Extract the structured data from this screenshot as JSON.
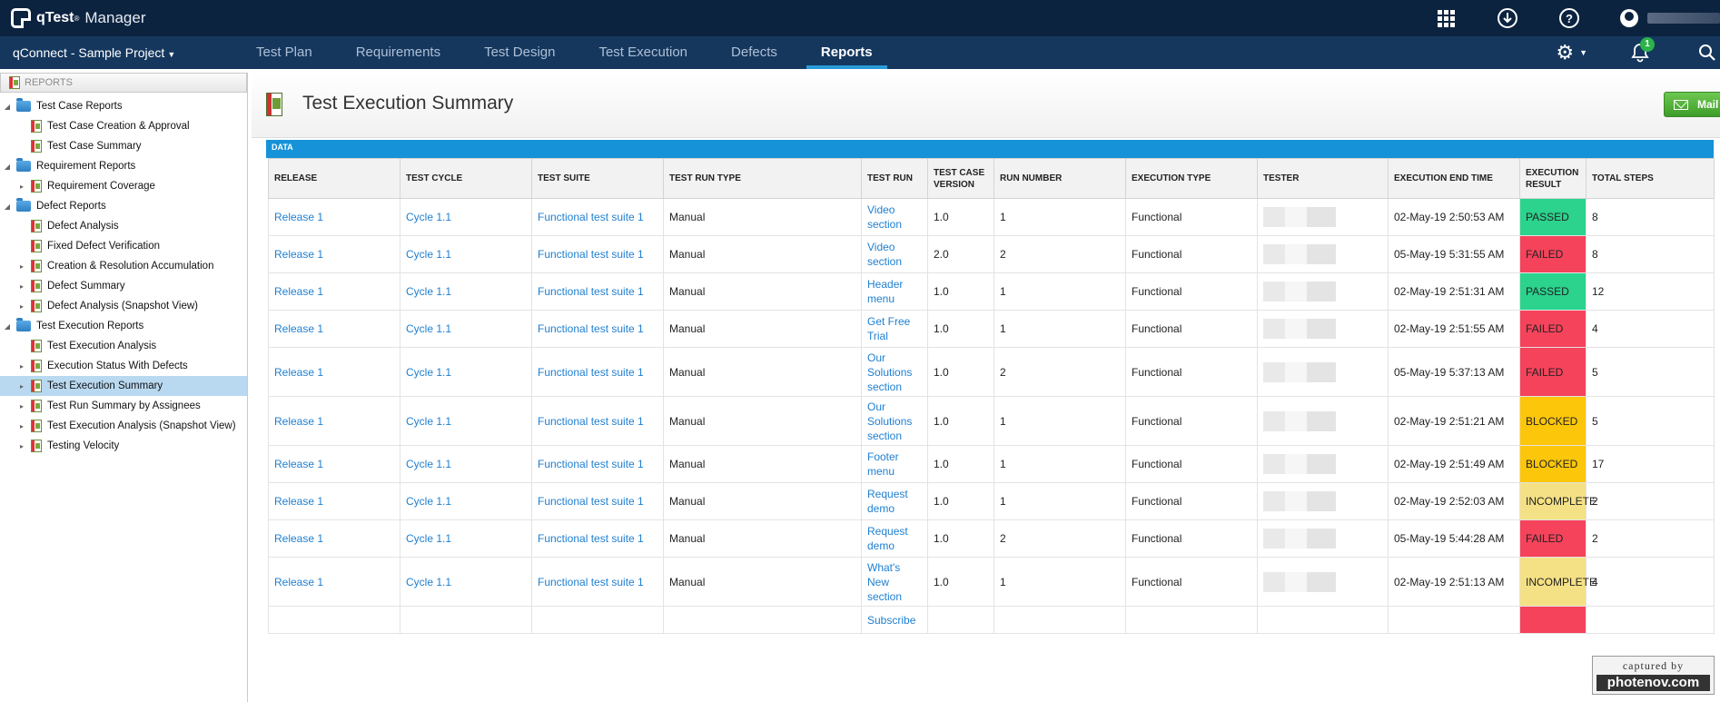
{
  "app": {
    "brand": "qTest",
    "trademark": "®",
    "product": "Manager"
  },
  "nav": {
    "project": "qConnect - Sample Project",
    "tabs": [
      {
        "label": "Test Plan",
        "active": false
      },
      {
        "label": "Requirements",
        "active": false
      },
      {
        "label": "Test Design",
        "active": false
      },
      {
        "label": "Test Execution",
        "active": false
      },
      {
        "label": "Defects",
        "active": false
      },
      {
        "label": "Reports",
        "active": true
      }
    ],
    "notification_count": "1",
    "help_icon": "?"
  },
  "sidebar": {
    "header": "REPORTS",
    "tree": [
      {
        "label": "Test Case Reports",
        "type": "folder",
        "level": 0,
        "expanded": true
      },
      {
        "label": "Test Case Creation & Approval",
        "type": "report",
        "level": 1,
        "expandable": false
      },
      {
        "label": "Test Case Summary",
        "type": "report",
        "level": 1,
        "expandable": false
      },
      {
        "label": "Requirement Reports",
        "type": "folder",
        "level": 0,
        "expanded": true
      },
      {
        "label": "Requirement Coverage",
        "type": "report",
        "level": 1,
        "expandable": true
      },
      {
        "label": "Defect Reports",
        "type": "folder",
        "level": 0,
        "expanded": true
      },
      {
        "label": "Defect Analysis",
        "type": "report",
        "level": 1,
        "expandable": false
      },
      {
        "label": "Fixed Defect Verification",
        "type": "report",
        "level": 1,
        "expandable": false
      },
      {
        "label": "Creation & Resolution Accumulation",
        "type": "report",
        "level": 1,
        "expandable": true
      },
      {
        "label": "Defect Summary",
        "type": "report",
        "level": 1,
        "expandable": true
      },
      {
        "label": "Defect Analysis (Snapshot View)",
        "type": "report",
        "level": 1,
        "expandable": true
      },
      {
        "label": "Test Execution Reports",
        "type": "folder",
        "level": 0,
        "expanded": true
      },
      {
        "label": "Test Execution Analysis",
        "type": "report",
        "level": 1,
        "expandable": false
      },
      {
        "label": "Execution Status With Defects",
        "type": "report",
        "level": 1,
        "expandable": true
      },
      {
        "label": "Test Execution Summary",
        "type": "report",
        "level": 1,
        "expandable": true,
        "selected": true
      },
      {
        "label": "Test Run Summary by Assignees",
        "type": "report",
        "level": 1,
        "expandable": true
      },
      {
        "label": "Test Execution Analysis (Snapshot View)",
        "type": "report",
        "level": 1,
        "expandable": true
      },
      {
        "label": "Testing Velocity",
        "type": "report",
        "level": 1,
        "expandable": true
      }
    ]
  },
  "main": {
    "title": "Test Execution Summary",
    "mail_label": "Mail",
    "data_label": "DATA",
    "columns": [
      "RELEASE",
      "TEST CYCLE",
      "TEST SUITE",
      "TEST RUN TYPE",
      "TEST RUN",
      "TEST CASE VERSION",
      "RUN NUMBER",
      "EXECUTION TYPE",
      "TESTER",
      "EXECUTION END TIME",
      "EXECUTION RESULT",
      "TOTAL STEPS"
    ],
    "rows": [
      {
        "release": "Release 1",
        "cycle": "Cycle 1.1",
        "suite": "Functional test suite 1",
        "run_type": "Manual",
        "test_run": "Video section",
        "version": "1.0",
        "run_number": "1",
        "exec_type": "Functional",
        "end_time": "02-May-19 2:50:53 AM",
        "result": "PASSED",
        "status": "passed",
        "steps": "8"
      },
      {
        "release": "Release 1",
        "cycle": "Cycle 1.1",
        "suite": "Functional test suite 1",
        "run_type": "Manual",
        "test_run": "Video section",
        "version": "2.0",
        "run_number": "2",
        "exec_type": "Functional",
        "end_time": "05-May-19 5:31:55 AM",
        "result": "FAILED",
        "status": "failed",
        "steps": "8"
      },
      {
        "release": "Release 1",
        "cycle": "Cycle 1.1",
        "suite": "Functional test suite 1",
        "run_type": "Manual",
        "test_run": "Header menu",
        "version": "1.0",
        "run_number": "1",
        "exec_type": "Functional",
        "end_time": "02-May-19 2:51:31 AM",
        "result": "PASSED",
        "status": "passed",
        "steps": "12"
      },
      {
        "release": "Release 1",
        "cycle": "Cycle 1.1",
        "suite": "Functional test suite 1",
        "run_type": "Manual",
        "test_run": "Get Free Trial",
        "version": "1.0",
        "run_number": "1",
        "exec_type": "Functional",
        "end_time": "02-May-19 2:51:55 AM",
        "result": "FAILED",
        "status": "failed",
        "steps": "4"
      },
      {
        "release": "Release 1",
        "cycle": "Cycle 1.1",
        "suite": "Functional test suite 1",
        "run_type": "Manual",
        "test_run": "Our Solutions section",
        "version": "1.0",
        "run_number": "2",
        "exec_type": "Functional",
        "end_time": "05-May-19 5:37:13 AM",
        "result": "FAILED",
        "status": "failed",
        "steps": "5"
      },
      {
        "release": "Release 1",
        "cycle": "Cycle 1.1",
        "suite": "Functional test suite 1",
        "run_type": "Manual",
        "test_run": "Our Solutions section",
        "version": "1.0",
        "run_number": "1",
        "exec_type": "Functional",
        "end_time": "02-May-19 2:51:21 AM",
        "result": "BLOCKED",
        "status": "blocked",
        "steps": "5"
      },
      {
        "release": "Release 1",
        "cycle": "Cycle 1.1",
        "suite": "Functional test suite 1",
        "run_type": "Manual",
        "test_run": "Footer menu",
        "version": "1.0",
        "run_number": "1",
        "exec_type": "Functional",
        "end_time": "02-May-19 2:51:49 AM",
        "result": "BLOCKED",
        "status": "blocked",
        "steps": "17"
      },
      {
        "release": "Release 1",
        "cycle": "Cycle 1.1",
        "suite": "Functional test suite 1",
        "run_type": "Manual",
        "test_run": "Request demo",
        "version": "1.0",
        "run_number": "1",
        "exec_type": "Functional",
        "end_time": "02-May-19 2:52:03 AM",
        "result": "INCOMPLETE",
        "status": "incomplete",
        "steps": "2"
      },
      {
        "release": "Release 1",
        "cycle": "Cycle 1.1",
        "suite": "Functional test suite 1",
        "run_type": "Manual",
        "test_run": "Request demo",
        "version": "1.0",
        "run_number": "2",
        "exec_type": "Functional",
        "end_time": "05-May-19 5:44:28 AM",
        "result": "FAILED",
        "status": "failed",
        "steps": "2"
      },
      {
        "release": "Release 1",
        "cycle": "Cycle 1.1",
        "suite": "Functional test suite 1",
        "run_type": "Manual",
        "test_run": "What's New section",
        "version": "1.0",
        "run_number": "1",
        "exec_type": "Functional",
        "end_time": "02-May-19 2:51:13 AM",
        "result": "INCOMPLETE",
        "status": "incomplete",
        "steps": "4"
      },
      {
        "release": "",
        "cycle": "",
        "suite": "",
        "run_type": "",
        "test_run": "Subscribe",
        "version": "",
        "run_number": "",
        "exec_type": "",
        "end_time": "",
        "result": "",
        "status": "failed",
        "steps": ""
      }
    ]
  },
  "watermark": {
    "top": "captured by",
    "bottom": "photenov.com"
  },
  "colors": {
    "header": "#0c2340",
    "nav": "#15375e",
    "accent": "#2a9bd7",
    "link": "#1f7fd0",
    "passed": "#2bd38d",
    "failed": "#f5435b",
    "blocked": "#fcc60a",
    "incomplete": "#f5e185"
  }
}
